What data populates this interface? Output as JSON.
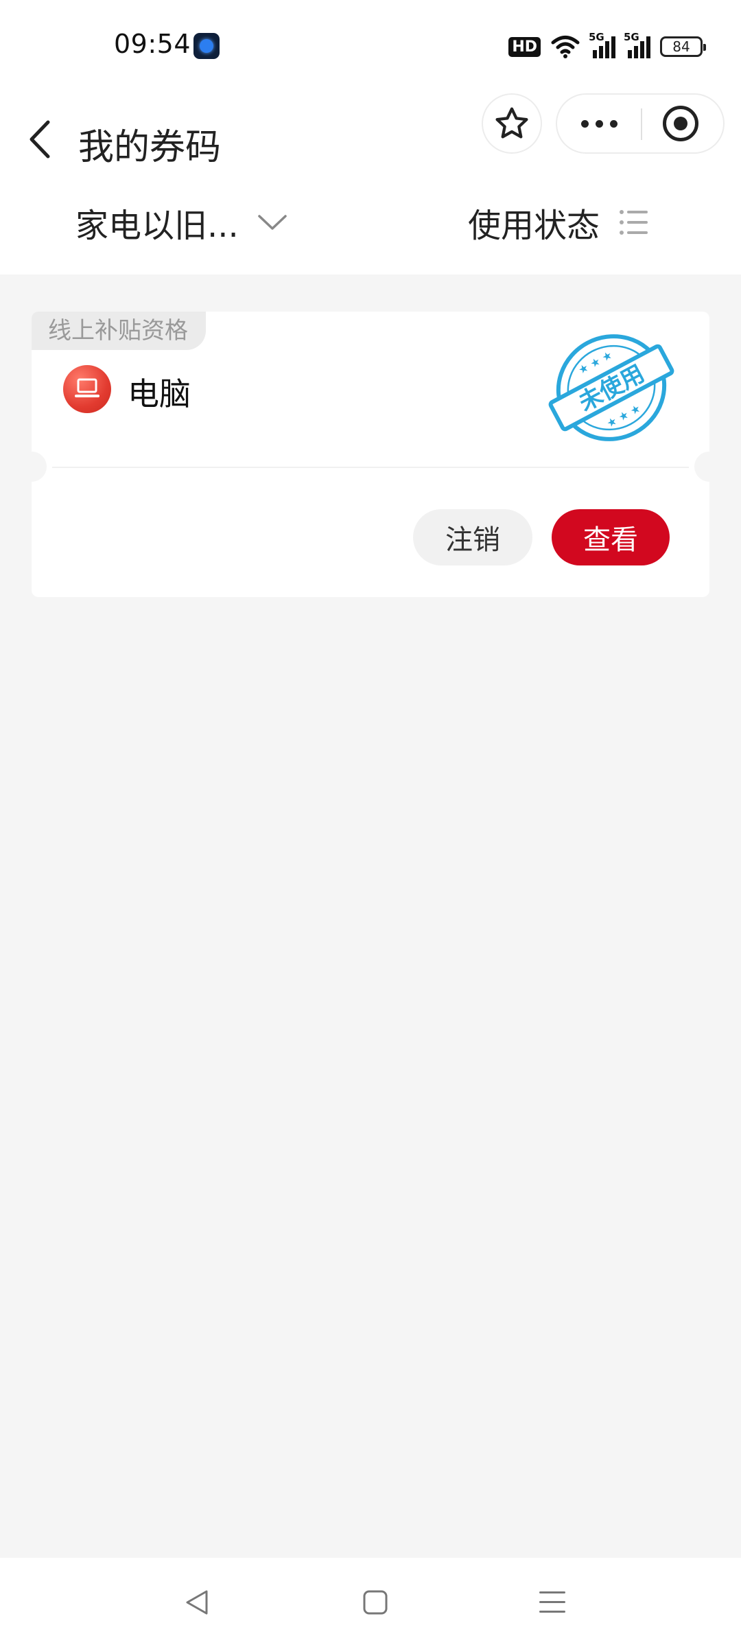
{
  "status_bar": {
    "time": "09:54",
    "hd_label": "HD",
    "signal1_label": "5G",
    "signal2_label": "5G",
    "battery": "84",
    "icons": [
      "app-shield-icon",
      "hd-icon",
      "wifi-icon",
      "signal-icon",
      "signal-icon",
      "battery-icon"
    ]
  },
  "nav": {
    "title": "我的券码",
    "icons": [
      "back-icon",
      "star-icon",
      "more-icon",
      "target-icon"
    ]
  },
  "filters": {
    "category": "家电以旧...",
    "status": "使用状态",
    "icons": [
      "chevron-down-icon",
      "list-icon"
    ]
  },
  "coupon": {
    "tag": "线上补贴资格",
    "product": "电脑",
    "stamp_text": "未使用",
    "cancel_label": "注销",
    "view_label": "查看",
    "icons": [
      "computer-icon",
      "stamp-icon"
    ]
  },
  "system_nav": {
    "icons": [
      "back-triangle-icon",
      "home-square-icon",
      "menu-lines-icon"
    ]
  },
  "colors": {
    "accent_red": "#d2081f",
    "stamp_blue": "#2aa7dc",
    "page_bg": "#f5f5f5"
  }
}
